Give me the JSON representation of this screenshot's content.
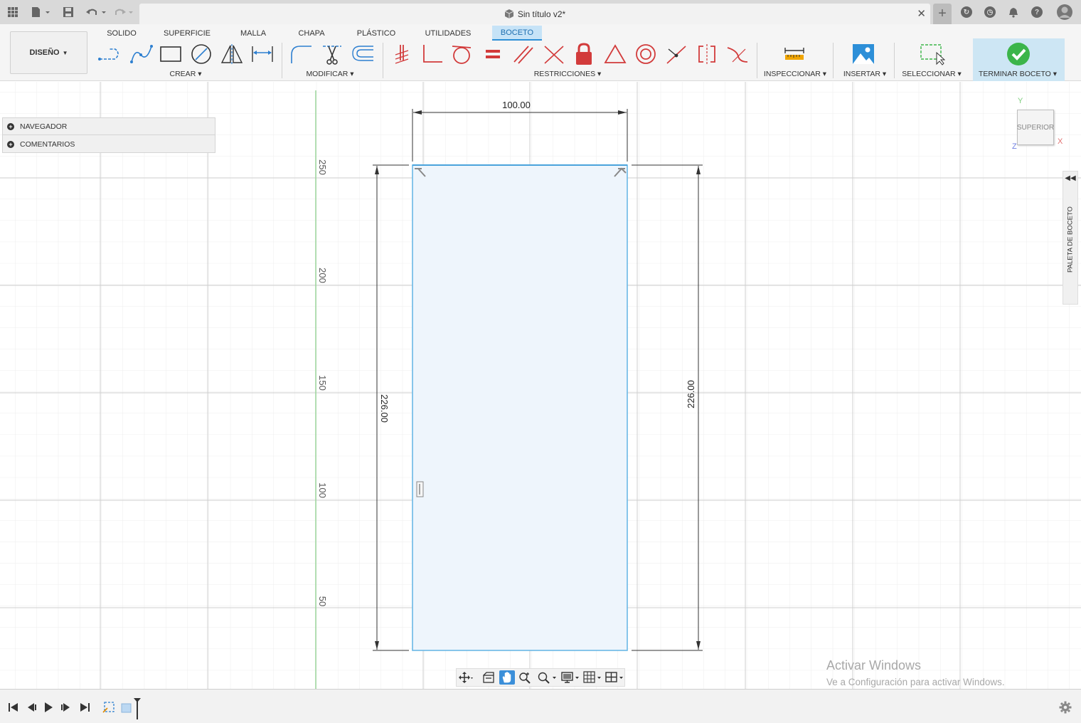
{
  "title_bar": {
    "document_title": "Sin título v2*"
  },
  "ribbon": {
    "workspace_button": "DISEÑO",
    "tabs": [
      "SOLIDO",
      "SUPERFICIE",
      "MALLA",
      "CHAPA",
      "PLÁSTICO",
      "UTILIDADES",
      "BOCETO"
    ],
    "active_tab": "BOCETO",
    "groups": {
      "create": "CREAR",
      "modify": "MODIFICAR",
      "constraints": "RESTRICCIONES",
      "inspect": "INSPECCIONAR",
      "insert": "INSERTAR",
      "select": "SELECCIONAR",
      "finish": "TERMINAR BOCETO"
    }
  },
  "browser": {
    "navigator": "NAVEGADOR",
    "comments": "COMENTARIOS"
  },
  "view_cube": {
    "face": "SUPERIOR",
    "axis_y": "Y",
    "axis_x": "X",
    "axis_z": "Z"
  },
  "sketch_palette": {
    "label": "PALETA DE BOCETO"
  },
  "sketch": {
    "ruler_ticks": [
      "250",
      "200",
      "150",
      "100",
      "50"
    ],
    "dim_width": "100.00",
    "dim_height_left": "226.00",
    "dim_height_right": "226.00"
  },
  "watermark": {
    "title": "Activar Windows",
    "subtitle": "Ve a Configuración para activar Windows."
  },
  "colors": {
    "accent": "#2e8fd6",
    "sketch_fill": "#eef5fc",
    "sketch_line": "#6ab8e6",
    "finish_green": "#3cb54a"
  }
}
